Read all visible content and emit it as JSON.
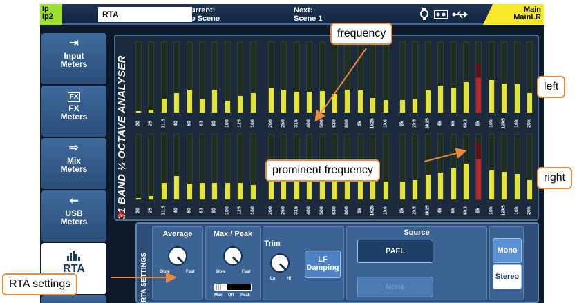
{
  "topbar": {
    "layer_line1": "Ip",
    "layer_line2": "Ip2",
    "view_name": "RTA",
    "current_label": "Current:",
    "current_value": "No Scene",
    "next_label": "Next:",
    "next_value": "Scene 1",
    "mix_line1": "Main",
    "mix_line2": "MainLR",
    "icons": [
      "mic-icon",
      "cassette-icon",
      "usb-icon"
    ]
  },
  "sidebar": {
    "items": [
      {
        "label1": "Input",
        "label2": "Meters",
        "icon": "input-icon"
      },
      {
        "label1": "FX",
        "label2": "Meters",
        "icon_text": "FX",
        "icon": "fx-icon"
      },
      {
        "label1": "Mix",
        "label2": "Meters",
        "icon": "output-icon"
      },
      {
        "label1": "USB",
        "label2": "Meters",
        "icon": "usb-icon"
      },
      {
        "label1": "RTA",
        "icon": "rta-icon",
        "active": true
      }
    ]
  },
  "analyser": {
    "title": "31 BAND ⅓ OCTAVE ANALYSER",
    "mark": "&",
    "bands": [
      "20",
      "25",
      "31.5",
      "40",
      "50",
      "63",
      "80",
      "100",
      "125",
      "160",
      "200",
      "250",
      "315",
      "400",
      "500",
      "630",
      "800",
      "1k",
      "1k25",
      "1k6",
      "2k",
      "2k5",
      "3k15",
      "4k",
      "5k",
      "6k3",
      "8k",
      "10k",
      "12k5",
      "16k",
      "20k"
    ],
    "left_levels": [
      0.02,
      0.04,
      0.2,
      0.27,
      0.32,
      0.19,
      0.32,
      0.17,
      0.24,
      0.27,
      0.34,
      0.32,
      0.29,
      0.29,
      0.3,
      0.26,
      0.32,
      0.31,
      0.21,
      0.18,
      0.18,
      0.19,
      0.31,
      0.38,
      0.35,
      0.43,
      0.71,
      0.46,
      0.41,
      0.4,
      0.27
    ],
    "right_levels": [
      0.02,
      0.05,
      0.26,
      0.36,
      0.24,
      0.26,
      0.26,
      0.26,
      0.26,
      0.22,
      0.28,
      0.3,
      0.3,
      0.28,
      0.28,
      0.3,
      0.28,
      0.28,
      0.28,
      0.28,
      0.28,
      0.3,
      0.38,
      0.42,
      0.48,
      0.55,
      0.88,
      0.45,
      0.43,
      0.39,
      0.3
    ],
    "peak_band_index": 26,
    "colors": {
      "bar": "#e4e43a",
      "peak_bar": "#c2222a",
      "peak_top": "#5e1217"
    }
  },
  "settings": {
    "title": "RTA SETTINGS",
    "average": {
      "label": "Average",
      "min": "Slow",
      "max": "Fast"
    },
    "max_peak": {
      "label": "Max / Peak",
      "min": "Slow",
      "max": "Fast",
      "switch_labels": [
        "Max",
        "Off",
        "Peak"
      ]
    },
    "trim": {
      "label": "Trim",
      "min": "Lo",
      "max": "Hi"
    },
    "lf_damping": {
      "line1": "LF",
      "line2": "Damping"
    },
    "source": {
      "label": "Source",
      "value": "PAFL",
      "second": "None"
    },
    "mode": {
      "options": [
        "Mono",
        "Stereo"
      ],
      "selected": "Mono"
    }
  },
  "annotations": {
    "frequency": "frequency",
    "left": "left",
    "prominent": "prominent frequency",
    "right": "right",
    "rta_settings": "RTA settings",
    "color": "#e98a3e"
  }
}
